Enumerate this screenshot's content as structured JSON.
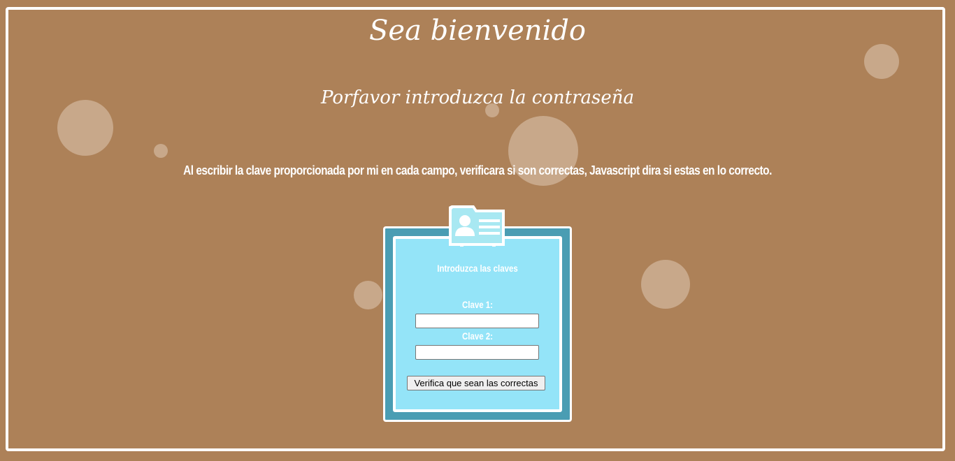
{
  "page": {
    "title": "Sea bienvenido",
    "subtitle": "Porfavor introduzca la contraseña",
    "instructions": "Al escribir la clave proporcionada por mi en cada campo, verificara si son correctas, Javascript dira si estas en lo correcto."
  },
  "form": {
    "heading": "Introduzca las claves",
    "field1_label": "Clave 1:",
    "field1_value": "",
    "field2_label": "Clave 2:",
    "field2_value": "",
    "verify_button": "Verifica que sean las correctas"
  },
  "colors": {
    "background": "#ad8158",
    "card_outer": "#4a9db3",
    "card_inner": "#94e4f8",
    "bubble": "#dec8b4"
  },
  "icons": {
    "badge": "id-card-icon"
  }
}
